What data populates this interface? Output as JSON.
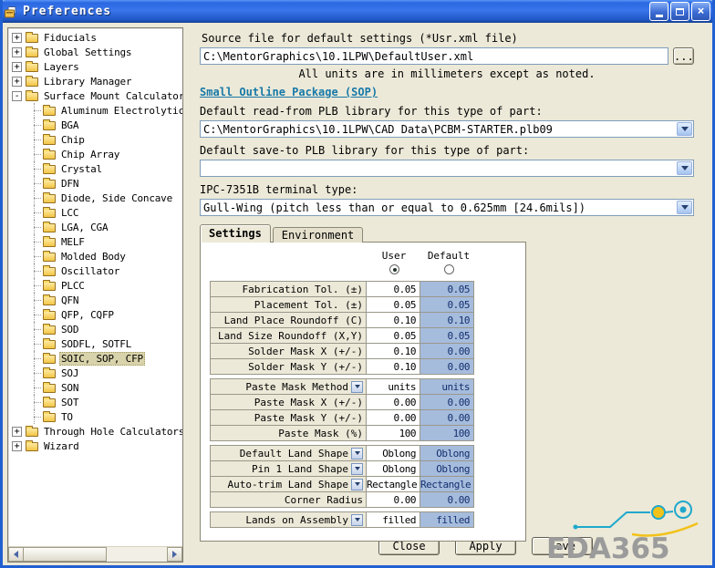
{
  "window": {
    "title": "Preferences"
  },
  "tree": {
    "items": [
      {
        "label": "Fiducials",
        "level": 0,
        "expander": "+"
      },
      {
        "label": "Global Settings",
        "level": 0,
        "expander": "+"
      },
      {
        "label": "Layers",
        "level": 0,
        "expander": "+"
      },
      {
        "label": "Library Manager",
        "level": 0,
        "expander": "+"
      },
      {
        "label": "Surface Mount Calculators",
        "level": 0,
        "expander": "-"
      },
      {
        "label": "Aluminum Electrolytic (",
        "level": 1
      },
      {
        "label": "BGA",
        "level": 1
      },
      {
        "label": "Chip",
        "level": 1
      },
      {
        "label": "Chip Array",
        "level": 1
      },
      {
        "label": "Crystal",
        "level": 1
      },
      {
        "label": "DFN",
        "level": 1
      },
      {
        "label": "Diode, Side Concave",
        "level": 1
      },
      {
        "label": "LCC",
        "level": 1
      },
      {
        "label": "LGA, CGA",
        "level": 1
      },
      {
        "label": "MELF",
        "level": 1
      },
      {
        "label": "Molded Body",
        "level": 1
      },
      {
        "label": "Oscillator",
        "level": 1
      },
      {
        "label": "PLCC",
        "level": 1
      },
      {
        "label": "QFN",
        "level": 1
      },
      {
        "label": "QFP, CQFP",
        "level": 1
      },
      {
        "label": "SOD",
        "level": 1
      },
      {
        "label": "SODFL, SOTFL",
        "level": 1
      },
      {
        "label": "SOIC, SOP, CFP",
        "level": 1,
        "selected": true
      },
      {
        "label": "SOJ",
        "level": 1
      },
      {
        "label": "SON",
        "level": 1
      },
      {
        "label": "SOT",
        "level": 1
      },
      {
        "label": "TO",
        "level": 1
      },
      {
        "label": "Through Hole Calculators",
        "level": 0,
        "expander": "+"
      },
      {
        "label": "Wizard",
        "level": 0,
        "expander": "+"
      }
    ]
  },
  "source": {
    "label": "Source file for default settings (*Usr.xml file)",
    "value": "C:\\MentorGraphics\\10.1LPW\\DefaultUser.xml",
    "browse_label": "..."
  },
  "notes": {
    "units": "All units are in millimeters except as noted."
  },
  "section": {
    "heading": "Small Outline Package (SOP)"
  },
  "fields": {
    "read_from": {
      "label": "Default read-from PLB library for this type of part:",
      "value": "C:\\MentorGraphics\\10.1LPW\\CAD Data\\PCBM-STARTER.plb09"
    },
    "save_to": {
      "label": "Default save-to PLB library for this type of part:",
      "value": ""
    },
    "terminal": {
      "label": "IPC-7351B terminal type:",
      "value": "Gull-Wing (pitch less than or equal to 0.625mm [24.6mils])"
    }
  },
  "tabs": {
    "settings": "Settings",
    "environment": "Environment"
  },
  "settings_table": {
    "columns": {
      "user": "User",
      "default": "Default"
    },
    "selected_column": "User",
    "rows": [
      {
        "label": "Fabrication Tol. (±)",
        "user": "0.05",
        "default": "0.05"
      },
      {
        "label": "Placement Tol. (±)",
        "user": "0.05",
        "default": "0.05"
      },
      {
        "label": "Land Place Roundoff (C)",
        "user": "0.10",
        "default": "0.10"
      },
      {
        "label": "Land Size Roundoff (X,Y)",
        "user": "0.05",
        "default": "0.05"
      },
      {
        "label": "Solder Mask X (+/-)",
        "user": "0.10",
        "default": "0.00"
      },
      {
        "label": "Solder Mask Y (+/-)",
        "user": "0.10",
        "default": "0.00",
        "gap_after": true
      },
      {
        "label": "Paste Mask Method",
        "dropdown": true,
        "user": "units",
        "default": "units"
      },
      {
        "label": "Paste Mask X (+/-)",
        "user": "0.00",
        "default": "0.00"
      },
      {
        "label": "Paste Mask Y (+/-)",
        "user": "0.00",
        "default": "0.00"
      },
      {
        "label": "Paste Mask (%)",
        "user": "100",
        "default": "100",
        "gap_after": true
      },
      {
        "label": "Default Land Shape",
        "dropdown": true,
        "user": "Oblong",
        "default": "Oblong"
      },
      {
        "label": "Pin 1 Land Shape",
        "dropdown": true,
        "user": "Oblong",
        "default": "Oblong"
      },
      {
        "label": "Auto-trim Land Shape",
        "dropdown": true,
        "user": "Rectangle",
        "default": "Rectangle"
      },
      {
        "label": "Corner Radius",
        "user": "0.00",
        "default": "0.00",
        "gap_after": true
      },
      {
        "label": "Lands on Assembly",
        "dropdown": true,
        "user": "filled",
        "default": "filled"
      }
    ]
  },
  "actions": {
    "close": "Close",
    "apply": "Apply",
    "save": "Save"
  },
  "watermark": {
    "text": "EDA365"
  }
}
